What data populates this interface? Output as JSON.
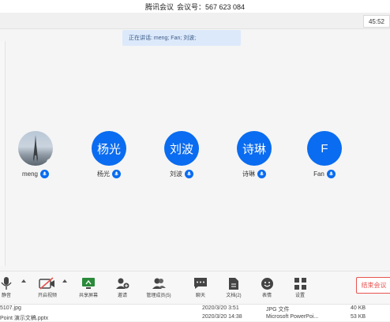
{
  "title": {
    "app_name": "腾讯会议",
    "meeting_id": "会议号：567 623 084"
  },
  "clock": "45:52",
  "speaking_banner": "正在讲话: meng; Fan; 刘波;",
  "participants": [
    {
      "name": "meng",
      "avatar_text": "",
      "avatar_type": "photo",
      "mic": "mic-icon"
    },
    {
      "name": "杨光",
      "avatar_text": "杨光",
      "avatar_type": "initials",
      "mic": "mic-icon"
    },
    {
      "name": "刘波",
      "avatar_text": "刘波",
      "avatar_type": "initials",
      "mic": "mic-icon"
    },
    {
      "name": "诗琳",
      "avatar_text": "诗琳",
      "avatar_type": "initials",
      "mic": "mic-icon"
    },
    {
      "name": "Fan",
      "avatar_text": "F",
      "avatar_type": "initials",
      "mic": "mic-icon"
    }
  ],
  "toolbar": {
    "mute": "静音",
    "video": "开启视频",
    "share": "共享屏幕",
    "invite": "邀请",
    "members": "管理成员(5)",
    "chat": "聊天",
    "docs": "文档(2)",
    "emoji": "表情",
    "settings": "设置",
    "end_meeting": "结束会议"
  },
  "files": [
    {
      "name": "5107.jpg",
      "date": "2020/3/20 3:51",
      "type": "JPG 文件",
      "size": "40 KB"
    },
    {
      "name": "Point 演示文稿.pptx",
      "date": "2020/3/20 14:38",
      "type": "Microsoft PowerPoi...",
      "size": "53 KB"
    }
  ],
  "colors": {
    "accent": "#0a6cf0",
    "banner_bg": "#dce9fb",
    "end_button": "#e8534f",
    "host_badge": "#f5b400"
  }
}
